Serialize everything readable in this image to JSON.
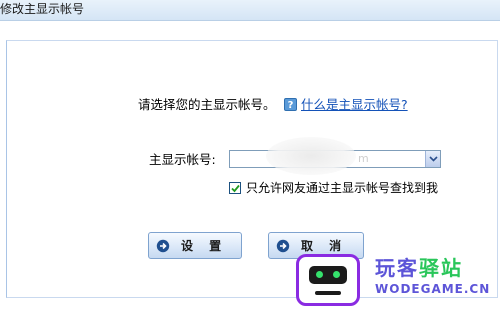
{
  "window": {
    "title": "修改主显示帐号"
  },
  "dialog": {
    "prompt": "请选择您的主显示帐号。",
    "help_icon": "question-icon",
    "help_link": "什么是主显示帐号?",
    "field_label": "主显示帐号:",
    "select_value": "m",
    "checkbox_label": "只允许网友通过主显示帐号查找到我",
    "checkbox_checked": true
  },
  "buttons": {
    "setup_label": "设 置",
    "cancel_label": "取 消"
  },
  "watermark": {
    "title_part1": "玩客",
    "title_part2": "驿站",
    "subtitle": "WODEGAME.CN"
  },
  "colors": {
    "link": "#1452b8",
    "titlebar": "#d5e5f5",
    "button_gradient_end": "#c6d9f1",
    "watermark_purple": "#5d55d8",
    "watermark_green": "#29c65a"
  }
}
